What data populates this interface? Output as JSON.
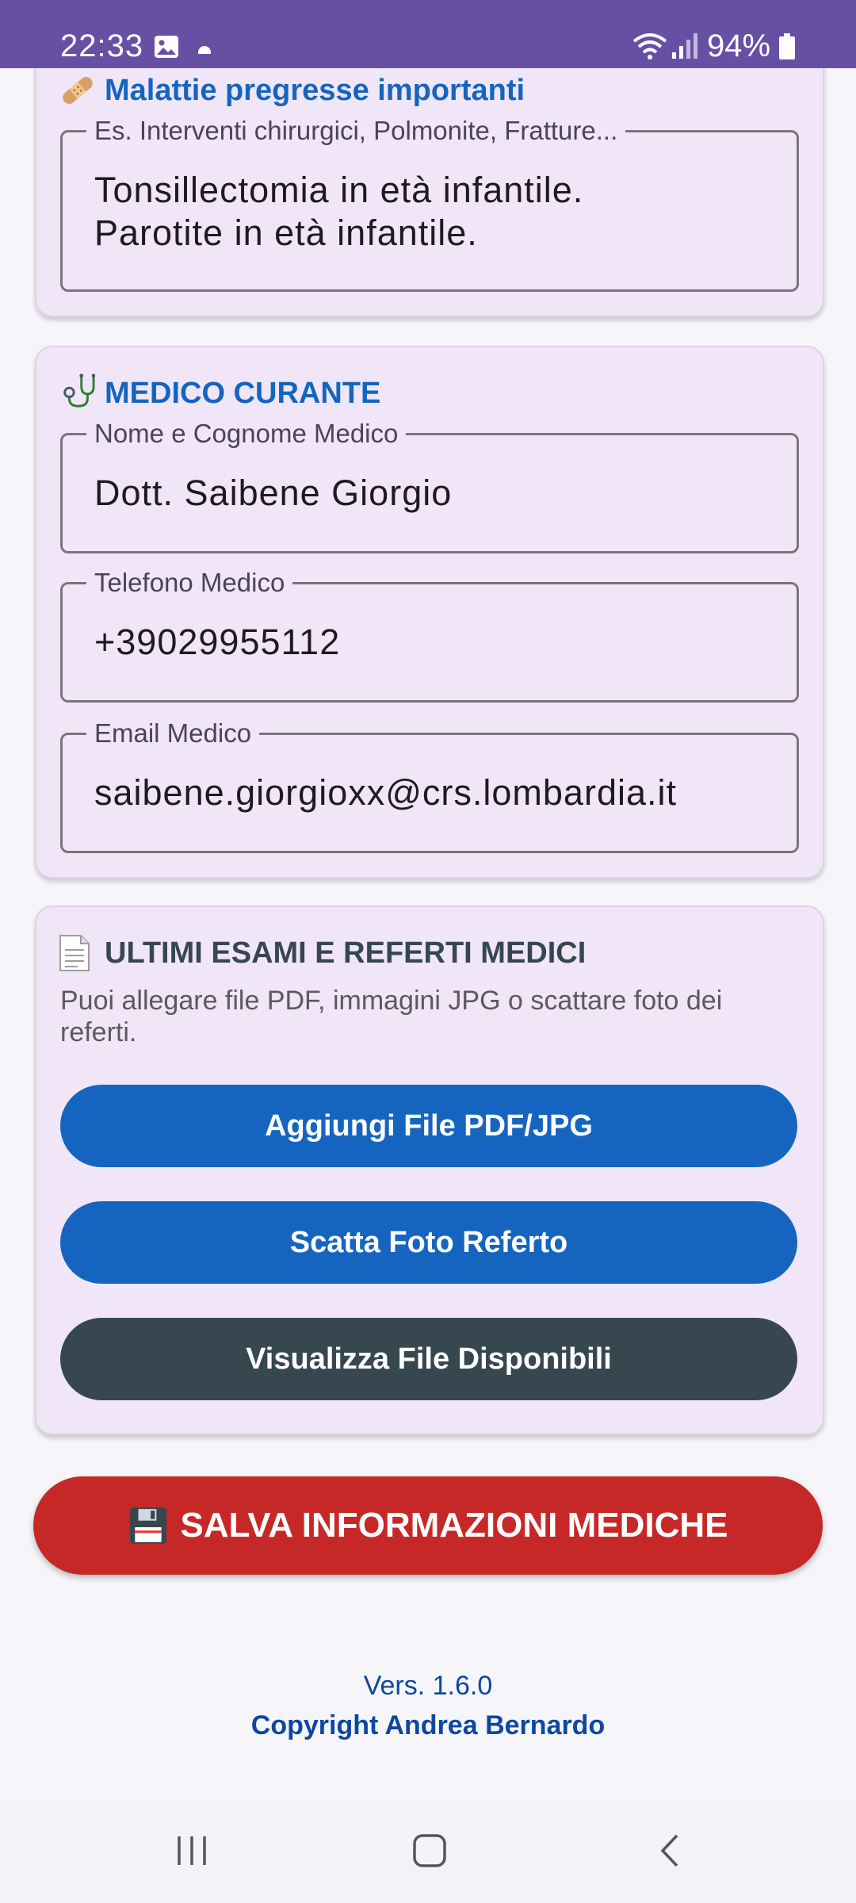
{
  "status_bar": {
    "time": "22:33",
    "battery": "94%"
  },
  "past_illnesses": {
    "title": "Malattie pregresse importanti",
    "field_label": "Es. Interventi chirurgici, Polmonite, Fratture...",
    "value_lines": [
      "Tonsillectomia in età infantile.",
      "Parotite in età infantile."
    ]
  },
  "doctor": {
    "title": "MEDICO CURANTE",
    "name_label": "Nome e Cognome Medico",
    "name_value": "Dott. Saibene Giorgio",
    "phone_label": "Telefono Medico",
    "phone_value": "+39029955112",
    "email_label": "Email Medico",
    "email_value": "saibene.giorgioxx@crs.lombardia.it"
  },
  "exams": {
    "title": "ULTIMI ESAMI E REFERTI MEDICI",
    "description": "Puoi allegare file PDF, immagini JPG o scattare foto dei referti.",
    "add_file_label": "Aggiungi File PDF/JPG",
    "take_photo_label": "Scatta Foto Referto",
    "view_files_label": "Visualizza File Disponibili"
  },
  "save_button_label": "SALVA INFORMAZIONI MEDICHE",
  "footer": {
    "version": "Vers. 1.6.0",
    "copyright": "Copyright Andrea Bernardo"
  },
  "colors": {
    "status_bar": "#6750a4",
    "card_bg": "#f0e6f7",
    "title_blue": "#1565c0",
    "button_blue": "#1565c0",
    "button_dark": "#37474f",
    "save_red": "#c62828"
  },
  "icons": [
    "image-icon",
    "wifi-icon",
    "signal-icon",
    "battery-icon",
    "bandage-icon",
    "stethoscope-icon",
    "document-icon",
    "floppy-disk-icon",
    "recent-apps-icon",
    "home-icon",
    "back-icon"
  ]
}
